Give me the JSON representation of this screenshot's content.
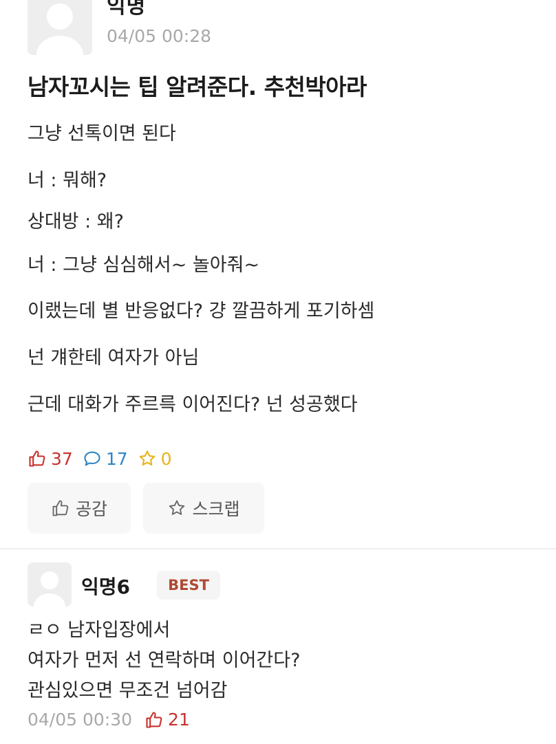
{
  "post": {
    "author": "익명",
    "time": "04/05 00:28",
    "title": "남자꼬시는 팁 알려준다. 추천박아라",
    "body": [
      "그냥 선톡이면 된다",
      "너 : 뭐해?",
      "상대방 : 왜?",
      "너 : 그냥 심심해서~ 놀아줘~",
      "이랬는데 별 반응없다? 걍 깔끔하게 포기하셈",
      "넌 걔한테 여자가 아님",
      "근데 대화가 주르륵 이어진다? 넌 성공했다"
    ],
    "stats": {
      "likes": "37",
      "comments": "17",
      "scraps": "0"
    },
    "actions": {
      "like_label": "공감",
      "scrap_label": "스크랩"
    }
  },
  "comment": {
    "author": "익명6",
    "badge": "BEST",
    "body": [
      "ㄹㅇ 남자입장에서",
      "여자가 먼저 선 연락하며 이어간다?",
      "관심있으면 무조건 넘어감"
    ],
    "time": "04/05 00:30",
    "likes": "21"
  },
  "colors": {
    "like": "#c8312c",
    "comment": "#2f86c5",
    "scrap": "#e8b31c",
    "best_badge": "#b04a35",
    "meta_gray": "#a8a8a8"
  },
  "icons": [
    "avatar-icon",
    "thumbs-up-icon",
    "speech-bubble-icon",
    "star-icon"
  ]
}
